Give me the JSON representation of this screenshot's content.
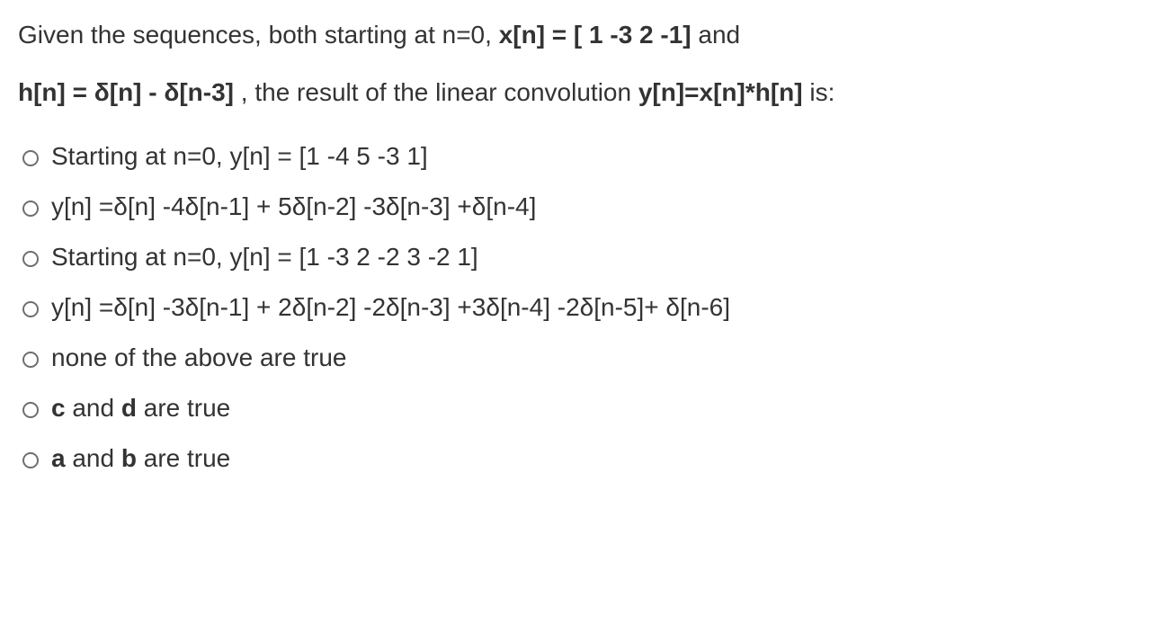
{
  "question": {
    "line1_prefix": "Given the sequences, both starting at n=0,  ",
    "line1_bold": "x[n] = [ 1  -3  2  -1]",
    "line1_suffix": "  and",
    "line2_bold1": "h[n] = δ[n] - δ[n-3]",
    "line2_mid": "  , the result of the linear convolution ",
    "line2_bold2": "y[n]=x[n]*h[n]",
    "line2_suffix": " is:"
  },
  "options": [
    {
      "text": "Starting at n=0, y[n] = [1  -4  5  -3  1]"
    },
    {
      "text": "y[n] =δ[n] -4δ[n-1] + 5δ[n-2] -3δ[n-3] +δ[n-4]"
    },
    {
      "text": "Starting at n=0, y[n] = [1  -3  2  -2  3  -2  1]"
    },
    {
      "text": "y[n] =δ[n] -3δ[n-1] + 2δ[n-2] -2δ[n-3] +3δ[n-4] -2δ[n-5]+ δ[n-6]"
    },
    {
      "text": "none of the above are true"
    },
    {
      "html": "<span class=\"bold\">c</span> and <span class=\"bold\">d</span> are true"
    },
    {
      "html": "<span class=\"bold\">a</span> and <span class=\"bold\">b</span> are true"
    }
  ]
}
